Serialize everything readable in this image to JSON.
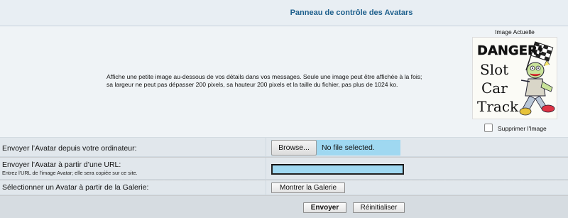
{
  "header": {
    "title": "Panneau de contrôle des Avatars"
  },
  "explanation": "Affiche une petite image au-dessous de vos détails dans vos messages. Seule une image peut être affichée à la fois; sa largeur ne peut pas dépasser 200 pixels, sa hauteur 200 pixels et la taille du fichier, pas plus de 1024 ko.",
  "current_avatar": {
    "title": "Image Actuelle",
    "image_text": [
      "DANGER!",
      "Slot",
      "Car",
      "Track"
    ],
    "delete_label": "Supprimer l'Image",
    "delete_checked": false
  },
  "upload": {
    "label": "Envoyer l’Avatar depuis votre ordinateur:",
    "browse_label": "Browse...",
    "file_status": "No file selected."
  },
  "url": {
    "label": "Envoyer l’Avatar à partir d’une URL:",
    "hint": "Entrez l'URL de l'image Avatar; elle sera copiée sur ce site.",
    "value": ""
  },
  "gallery": {
    "label": "Sélectionner un Avatar à partir de la Galerie:",
    "button_label": "Montrer la Galerie"
  },
  "actions": {
    "submit_label": "Envoyer",
    "reset_label": "Réinitialiser"
  },
  "colors": {
    "header_text": "#1d5f8c",
    "input_fill": "#9fd8f1"
  }
}
